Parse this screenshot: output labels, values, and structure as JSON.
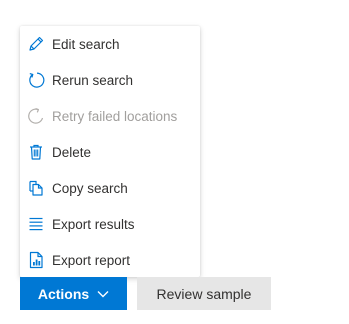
{
  "colors": {
    "accent": "#0078d4",
    "text": "#323130",
    "disabled": "#a19f9d",
    "secondary_button_bg": "#e6e6e6"
  },
  "menu": {
    "items": [
      {
        "label": "Edit search",
        "icon": "pencil-icon",
        "disabled": false
      },
      {
        "label": "Rerun search",
        "icon": "refresh-icon",
        "disabled": false
      },
      {
        "label": "Retry failed locations",
        "icon": "retry-icon",
        "disabled": true
      },
      {
        "label": "Delete",
        "icon": "trash-icon",
        "disabled": false
      },
      {
        "label": "Copy search",
        "icon": "copy-icon",
        "disabled": false
      },
      {
        "label": "Export results",
        "icon": "list-icon",
        "disabled": false
      },
      {
        "label": "Export report",
        "icon": "report-icon",
        "disabled": false
      }
    ]
  },
  "buttons": {
    "actions_label": "Actions",
    "review_label": "Review sample"
  }
}
